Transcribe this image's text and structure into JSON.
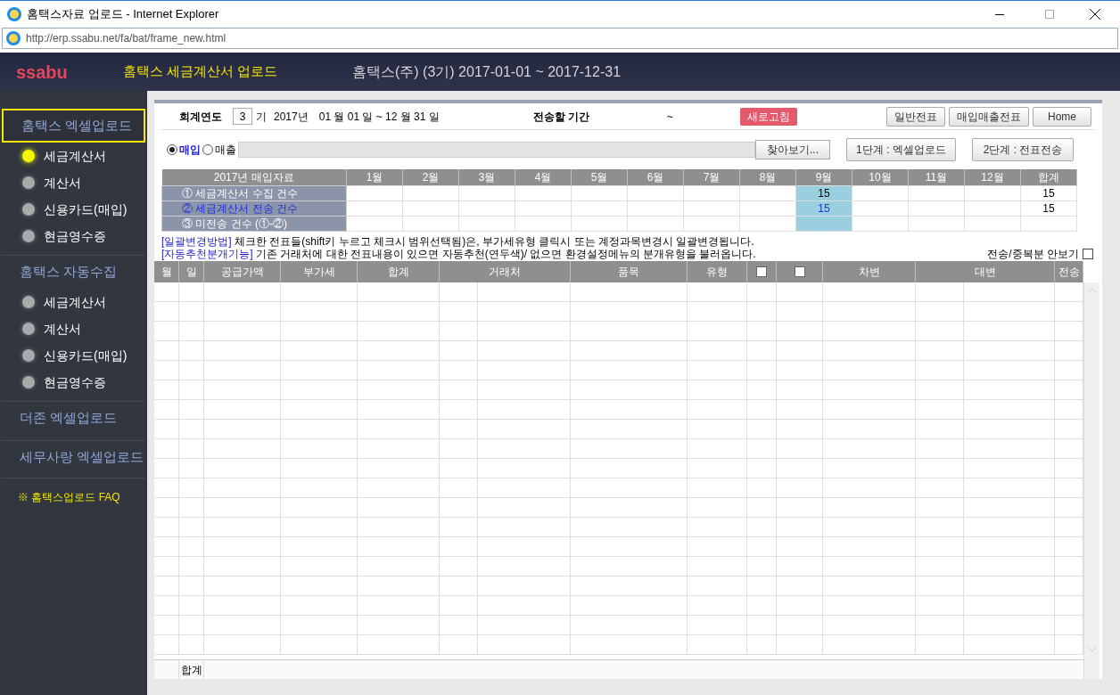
{
  "window": {
    "title": "홈택스자료 업로드 - Internet Explorer",
    "address": "http://erp.ssabu.net/fa/bat/frame_new.html"
  },
  "header": {
    "logo": "ssabu",
    "title": "홈택스 세금계산서 업로드",
    "company": "홈택스(주) (3기) 2017-01-01 ~ 2017-12-31"
  },
  "sidebar": [
    {
      "kind": "section",
      "label": "홈택스 엑셀업로드",
      "selected": true
    },
    {
      "kind": "item",
      "label": "세금계산서",
      "on": true
    },
    {
      "kind": "item",
      "label": "계산서",
      "on": false
    },
    {
      "kind": "item",
      "label": "신용카드(매입)",
      "on": false
    },
    {
      "kind": "item",
      "label": "현금영수증",
      "on": false
    },
    {
      "kind": "section",
      "label": "홈택스 자동수집",
      "selected": false
    },
    {
      "kind": "item",
      "label": "세금계산서",
      "on": false
    },
    {
      "kind": "item",
      "label": "계산서",
      "on": false
    },
    {
      "kind": "item",
      "label": "신용카드(매입)",
      "on": false
    },
    {
      "kind": "item",
      "label": "현금영수증",
      "on": false
    },
    {
      "kind": "section",
      "label": "더존 엑셀업로드",
      "selected": false
    },
    {
      "kind": "section",
      "label": "세무사랑 엑셀업로드",
      "selected": false
    },
    {
      "kind": "faq",
      "label": "※ 홈택스업로드 FAQ"
    }
  ],
  "toolbar": {
    "year_label": "회계연도",
    "term": "3",
    "term_unit": "기",
    "year": "2017년",
    "period": "01 월 01 일 ~ 12 월 31 일",
    "send_period_label": "전송할 기간",
    "send_period": "~",
    "refresh": "새로고침",
    "buttons": [
      "일반전표",
      "매입매출전표",
      "Home"
    ]
  },
  "file_row": {
    "radios": [
      {
        "label": "매입",
        "selected": true
      },
      {
        "label": "매출",
        "selected": false
      }
    ],
    "browse": "찾아보기...",
    "steps": [
      "1단계 : 엑셀업로드",
      "2단계 : 전표전송"
    ]
  },
  "summary": {
    "title": "2017년 매입자료",
    "columns": [
      {
        "label": "1월",
        "selected": false
      },
      {
        "label": "2월",
        "selected": false
      },
      {
        "label": "3월",
        "selected": false
      },
      {
        "label": "4월",
        "selected": false
      },
      {
        "label": "5월",
        "selected": false
      },
      {
        "label": "6월",
        "selected": false
      },
      {
        "label": "7월",
        "selected": false
      },
      {
        "label": "8월",
        "selected": false
      },
      {
        "label": "9월",
        "selected": true,
        "collected": "15",
        "sent": "15"
      },
      {
        "label": "10월",
        "selected": false
      },
      {
        "label": "11월",
        "selected": false
      },
      {
        "label": "12월",
        "selected": false
      },
      {
        "label": "합계",
        "selected": false,
        "collected": "15",
        "sent": "15"
      }
    ],
    "rows": [
      {
        "kind": "plain",
        "label": "① 세금계산서 수집 건수"
      },
      {
        "kind": "link",
        "label": "② 세금계산서 전송 건수"
      },
      {
        "kind": "plain",
        "label": "③ 미전송 건수 (①-②)"
      }
    ]
  },
  "notes": [
    {
      "tag": "[일괄변경방법]",
      "text": "체크한 전표들(shift키 누르고 체크시 범위선택됨)은, 부가세유형 클릭시 또는 계정과목변경시 일괄변경됩니다."
    },
    {
      "tag": "[자동추천분개기능]",
      "text": "기존 거래처에 대한 전표내용이 있으면 자동추천(연두색)/ 없으면 환경설정메뉴의 분개유형을 불러옵니다."
    }
  ],
  "hide_sent": {
    "label": "전송/중복분 안보기",
    "checked": false
  },
  "grid": {
    "columns": [
      {
        "kind": "text",
        "label": "월"
      },
      {
        "kind": "text",
        "label": "일"
      },
      {
        "kind": "text",
        "label": "공급가액"
      },
      {
        "kind": "text",
        "label": "부가세"
      },
      {
        "kind": "text",
        "label": "합계"
      },
      {
        "kind": "text",
        "label": "거래처"
      },
      {
        "kind": "text",
        "label": "품목"
      },
      {
        "kind": "text",
        "label": "유형"
      },
      {
        "kind": "check",
        "checked": false
      },
      {
        "kind": "check",
        "checked": false
      },
      {
        "kind": "text",
        "label": "차변"
      },
      {
        "kind": "text",
        "label": "대변"
      },
      {
        "kind": "text",
        "label": "전송"
      }
    ],
    "total_label": "합계"
  }
}
